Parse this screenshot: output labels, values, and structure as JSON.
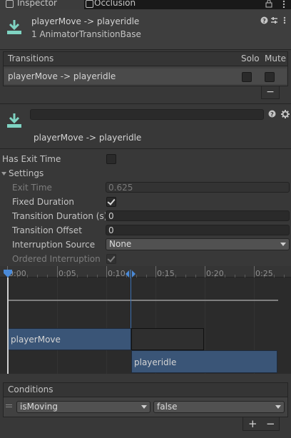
{
  "tabs": {
    "inspector": "Inspector",
    "occlusion": "Occlusion"
  },
  "header": {
    "title": "playerMove -> playeridle",
    "subtitle": "1 AnimatorTransitionBase"
  },
  "transitions_list": {
    "title": "Transitions",
    "solo_label": "Solo",
    "mute_label": "Mute",
    "items": [
      {
        "label": "playerMove -> playeridle",
        "solo": false,
        "mute": false
      }
    ],
    "remove_label": "−"
  },
  "transition": {
    "name_value": "",
    "label": "playerMove -> playeridle",
    "has_exit_time_label": "Has Exit Time",
    "has_exit_time": false,
    "settings_label": "Settings",
    "exit_time_label": "Exit Time",
    "exit_time_value": "0.625",
    "fixed_duration_label": "Fixed Duration",
    "fixed_duration": true,
    "transition_duration_label": "Transition Duration (s)",
    "transition_duration_value": "0",
    "transition_offset_label": "Transition Offset",
    "transition_offset_value": "0",
    "interruption_source_label": "Interruption Source",
    "interruption_source_value": "None",
    "ordered_interruption_label": "Ordered Interruption",
    "ordered_interruption": true
  },
  "timeline": {
    "ticks": [
      "0:00",
      "0:05",
      "0:10",
      "0:15",
      "0:20",
      "0:25"
    ],
    "source_state": "playerMove",
    "dest_state": "playeridle"
  },
  "conditions": {
    "title": "Conditions",
    "items": [
      {
        "parameter": "isMoving",
        "value": "false"
      }
    ],
    "add_label": "+",
    "remove_label": "−"
  },
  "colors": {
    "accent": "#2c5d87",
    "state_bar": "#3a5577",
    "panel": "#383838"
  }
}
